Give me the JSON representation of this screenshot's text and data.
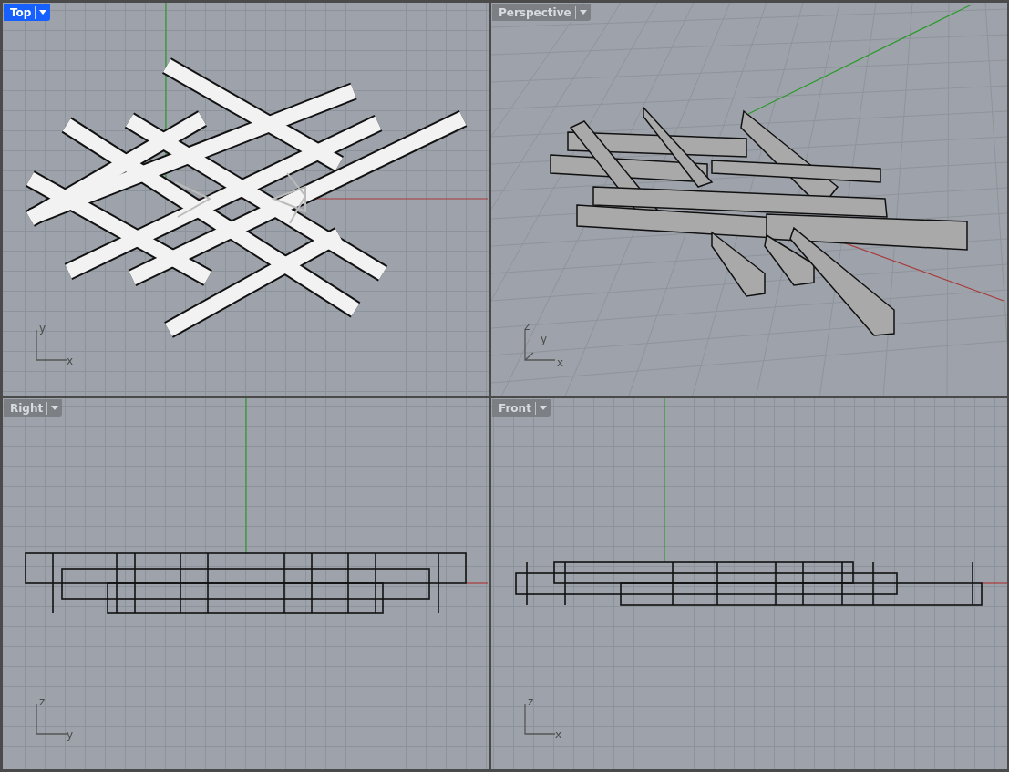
{
  "viewports": [
    {
      "title": "Top",
      "selected": true,
      "kind": "top",
      "axes": [
        "y",
        "x"
      ]
    },
    {
      "title": "Perspective",
      "selected": false,
      "kind": "perspective",
      "axes": [
        "z",
        "y",
        "x"
      ]
    },
    {
      "title": "Right",
      "selected": false,
      "kind": "right",
      "axes": [
        "z",
        "y"
      ]
    },
    {
      "title": "Front",
      "selected": false,
      "kind": "front",
      "axes": [
        "z",
        "x"
      ]
    }
  ]
}
